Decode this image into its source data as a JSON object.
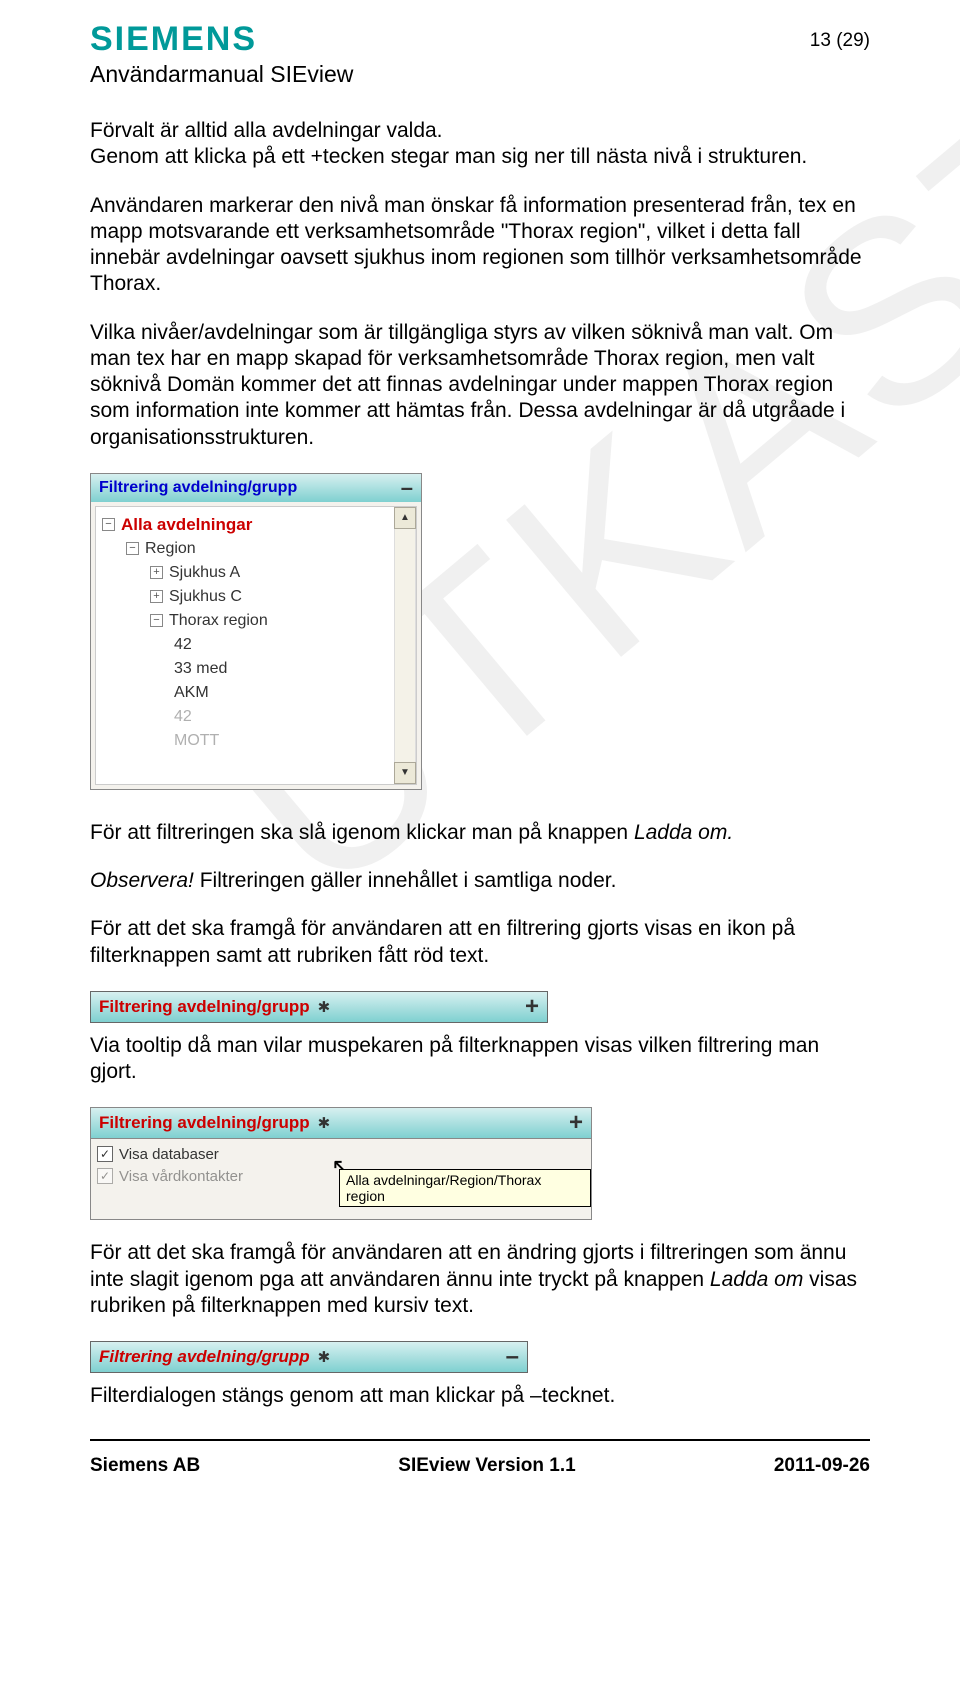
{
  "header": {
    "logo": "SIEMENS",
    "manual_title": "Användarmanual SIEview",
    "page_num": "13 (29)"
  },
  "watermark": "UTKAST",
  "paragraphs": {
    "p1": "Förvalt är alltid alla avdelningar valda.\nGenom att klicka på ett +tecken stegar man sig ner till nästa nivå i strukturen.",
    "p2": "Användaren markerar den nivå man önskar få information presenterad från, tex en mapp motsvarande ett verksamhetsområde \"Thorax region\", vilket i detta fall innebär avdelningar oavsett sjukhus inom regionen som tillhör verksamhetsområde Thorax.",
    "p3": "Vilka nivåer/avdelningar som är tillgängliga styrs av vilken söknivå man valt. Om man tex har en mapp skapad för verksamhetsområde Thorax region, men valt söknivå Domän kommer det att finnas avdelningar under mappen Thorax region som information inte kommer att hämtas från. Dessa avdelningar är då utgråade i organisationsstrukturen.",
    "p4a": "För att filtreringen ska slå igenom klickar man på knappen ",
    "p4b": "Ladda om.",
    "p5a": "Observera!",
    "p5b": " Filtreringen gäller innehållet i samtliga noder.",
    "p6": "För att det ska framgå för användaren att en filtrering gjorts visas en ikon på filterknappen samt att rubriken fått röd text.",
    "p7": "Via tooltip då man vilar muspekaren på filterknappen visas vilken filtrering man gjort.",
    "p8a": "För att det ska framgå för användaren att en ändring gjorts i filtreringen som ännu inte slagit igenom pga att användaren ännu inte tryckt på knappen ",
    "p8b": "Ladda om",
    "p8c": " visas rubriken på filterknappen med kursiv text.",
    "p9": "Filterdialogen stängs genom att man klickar på –tecknet."
  },
  "panel1": {
    "title": "Filtrering avdelning/grupp",
    "toggle": "–",
    "tree": {
      "root": "Alla avdelningar",
      "region": "Region",
      "sjukhus_a": "Sjukhus A",
      "sjukhus_c": "Sjukhus C",
      "thorax": "Thorax region",
      "n42": "42",
      "n33": "33 med",
      "akm": "AKM",
      "n42b": "42",
      "mott": "MOTT"
    },
    "box_minus": "−",
    "box_plus": "+",
    "arrow_up": "▲",
    "arrow_down": "▼"
  },
  "headerbar_red": {
    "title": "Filtrering avdelning/grupp",
    "gear": "✱",
    "plus": "+",
    "minus": "–"
  },
  "tooltip_panel": {
    "title": "Filtrering avdelning/grupp",
    "gear": "✱",
    "plus": "+",
    "check": "✓",
    "row1": "Visa databaser",
    "row2": "Visa vårdkontakter",
    "cursor": "↖",
    "tooltip": "Alla avdelningar/Region/Thorax region"
  },
  "footer": {
    "left": "Siemens AB",
    "center": "SIEview Version 1.1",
    "right": "2011-09-26"
  }
}
